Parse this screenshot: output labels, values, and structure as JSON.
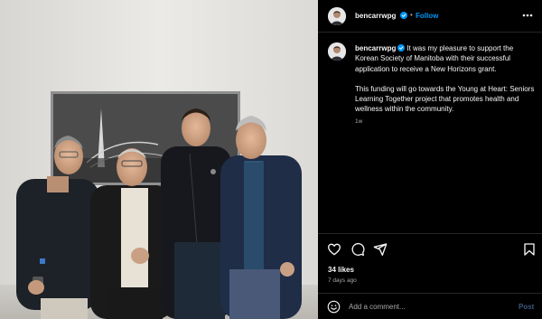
{
  "post": {
    "username": "bencarrwpg",
    "verified": true,
    "separator": "•",
    "follow_label": "Follow",
    "caption_line1": "It was my pleasure to support the Korean Society of Manitoba with their successful application to receive a New Horizons grant.",
    "caption_line2": "This funding will go towards the Young at Heart: Seniors Learning Together project that promotes health and wellness within the community.",
    "caption_age": "1w",
    "likes": "34 likes",
    "posted_ago": "7 days ago"
  },
  "comment": {
    "placeholder": "Add a comment...",
    "post_label": "Post"
  },
  "icons": {
    "more": "more-options-icon",
    "verified": "verified-badge-icon",
    "like": "heart-icon",
    "comment": "comment-bubble-icon",
    "share": "send-paper-plane-icon",
    "save": "bookmark-icon",
    "emoji": "smiley-face-icon"
  },
  "colors": {
    "background": "#000000",
    "link_blue": "#0095f6",
    "muted_text": "#a8a8a8",
    "divider": "#262626"
  }
}
